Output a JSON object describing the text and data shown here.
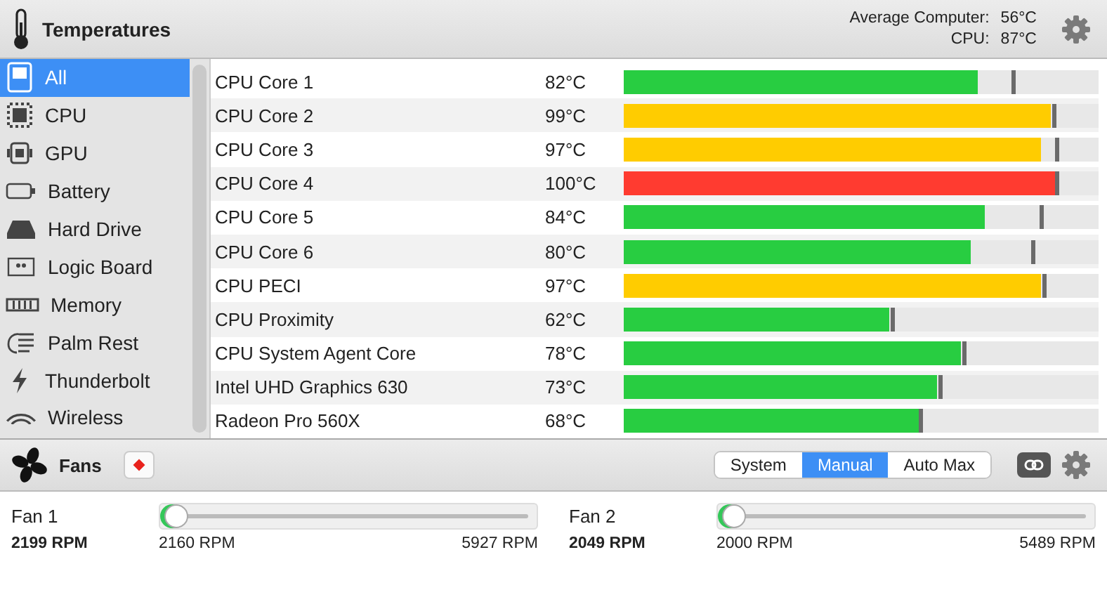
{
  "header": {
    "title": "Temperatures",
    "summary": [
      {
        "label": "Average Computer:",
        "value": "56°C"
      },
      {
        "label": "CPU:",
        "value": "87°C"
      }
    ]
  },
  "sidebar": {
    "items": [
      {
        "label": "All",
        "kind": "all",
        "selected": true
      },
      {
        "label": "CPU",
        "kind": "cpu",
        "selected": false
      },
      {
        "label": "GPU",
        "kind": "gpu",
        "selected": false
      },
      {
        "label": "Battery",
        "kind": "battery",
        "selected": false
      },
      {
        "label": "Hard Drive",
        "kind": "drive",
        "selected": false
      },
      {
        "label": "Logic Board",
        "kind": "board",
        "selected": false
      },
      {
        "label": "Memory",
        "kind": "memory",
        "selected": false
      },
      {
        "label": "Palm Rest",
        "kind": "palm",
        "selected": false
      },
      {
        "label": "Thunderbolt",
        "kind": "bolt",
        "selected": false
      },
      {
        "label": "Wireless",
        "kind": "wireless",
        "selected": false
      }
    ]
  },
  "sensors": [
    {
      "name": "CPU Core 1",
      "value": "82°C",
      "level": 0.745,
      "peak": {
        "level": 0.82
      },
      "color": "#28cd41"
    },
    {
      "name": "CPU Core 2",
      "value": "99°C",
      "level": 0.9,
      "peak": {
        "level": 0.905
      },
      "color": "#ffcc00"
    },
    {
      "name": "CPU Core 3",
      "value": "97°C",
      "level": 0.88,
      "peak": {
        "level": 0.91
      },
      "color": "#ffcc00"
    },
    {
      "name": "CPU Core 4",
      "value": "100°C",
      "level": 0.91,
      "peak": {
        "level": 0.912
      },
      "color": "#ff3b30"
    },
    {
      "name": "CPU Core 5",
      "value": "84°C",
      "level": 0.76,
      "peak": {
        "level": 0.88
      },
      "color": "#28cd41"
    },
    {
      "name": "CPU Core 6",
      "value": "80°C",
      "level": 0.73,
      "peak": {
        "level": 0.86
      },
      "color": "#28cd41"
    },
    {
      "name": "CPU PECI",
      "value": "97°C",
      "level": 0.88,
      "peak": {
        "level": 0.885
      },
      "color": "#ffcc00"
    },
    {
      "name": "CPU Proximity",
      "value": "62°C",
      "level": 0.56,
      "peak": {
        "level": 0.565
      },
      "color": "#28cd41"
    },
    {
      "name": "CPU System Agent Core",
      "value": "78°C",
      "level": 0.71,
      "peak": {
        "level": 0.715
      },
      "color": "#28cd41"
    },
    {
      "name": "Intel UHD Graphics 630",
      "value": "73°C",
      "level": 0.66,
      "peak": {
        "level": 0.665
      },
      "color": "#28cd41"
    },
    {
      "name": "Radeon Pro 560X",
      "value": "68°C",
      "level": 0.62,
      "peak": {
        "level": 0.625
      },
      "color": "#28cd41"
    }
  ],
  "fans_bar": {
    "title": "Fans",
    "modes": [
      {
        "label": "System",
        "selected": false
      },
      {
        "label": "Manual",
        "selected": true
      },
      {
        "label": "Auto Max",
        "selected": false
      }
    ]
  },
  "fans": [
    {
      "name": "Fan 1",
      "speed": "2199 RPM",
      "min": "2160 RPM",
      "max": "5927 RPM",
      "level": 0.0
    },
    {
      "name": "Fan 2",
      "speed": "2049 RPM",
      "min": "2000 RPM",
      "max": "5489 RPM",
      "level": 0.0
    }
  ]
}
